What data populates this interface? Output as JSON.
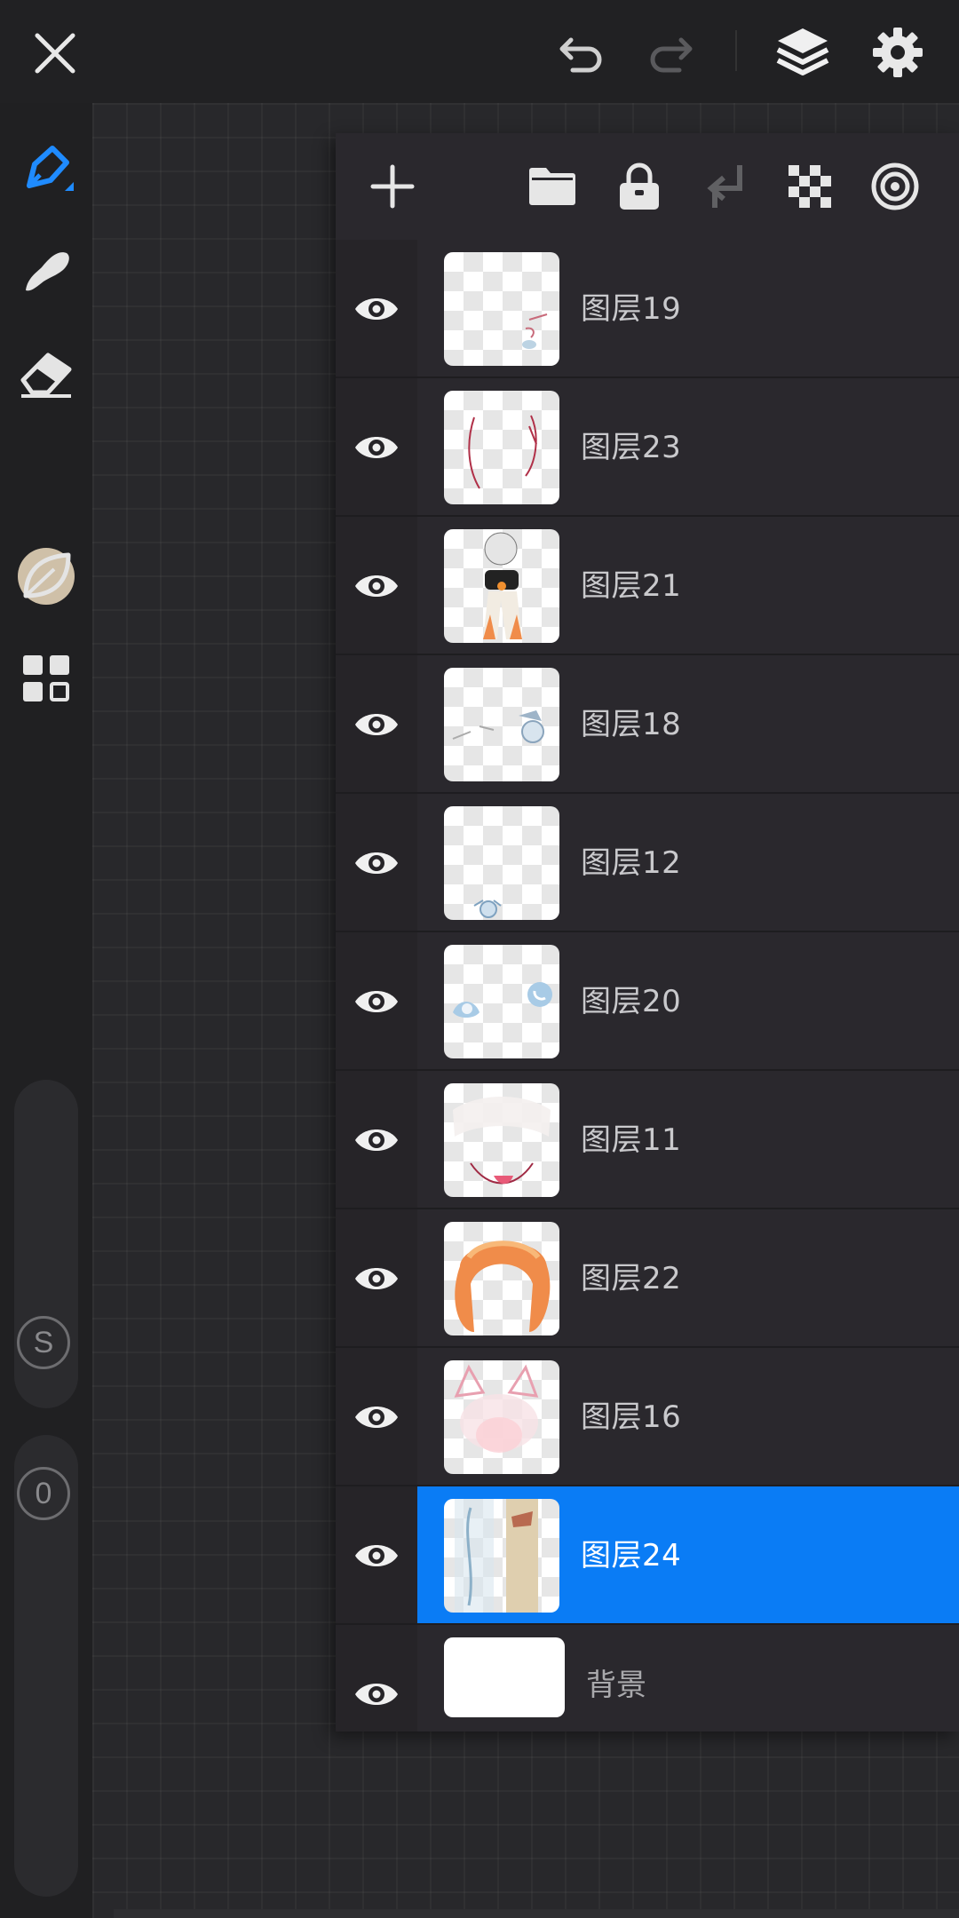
{
  "topbar": {
    "close_icon": "close-icon",
    "undo_icon": "undo-icon",
    "redo_icon": "redo-icon",
    "layers_icon": "layers-icon",
    "settings_icon": "gear-icon"
  },
  "toolbar": {
    "tools": [
      "pen-tool-icon",
      "smudge-tool-icon",
      "eraser-tool-icon",
      "color-swatch",
      "leaf-icon",
      "grid-icon"
    ],
    "current_color": "#cfc0a8",
    "size_slider_label": "S",
    "opacity_slider_label": "0"
  },
  "layers_panel": {
    "toolbar_icons": [
      "add-layer-icon",
      "folder-icon",
      "lock-icon",
      "merge-down-icon",
      "transparency-icon",
      "target-icon"
    ],
    "layers": [
      {
        "name": "图层19",
        "visible": true,
        "active": false
      },
      {
        "name": "图层23",
        "visible": true,
        "active": false
      },
      {
        "name": "图层21",
        "visible": true,
        "active": false
      },
      {
        "name": "图层18",
        "visible": true,
        "active": false
      },
      {
        "name": "图层12",
        "visible": true,
        "active": false
      },
      {
        "name": "图层20",
        "visible": true,
        "active": false
      },
      {
        "name": "图层11",
        "visible": true,
        "active": false
      },
      {
        "name": "图层22",
        "visible": true,
        "active": false
      },
      {
        "name": "图层16",
        "visible": true,
        "active": false
      },
      {
        "name": "图层24",
        "visible": true,
        "active": true
      }
    ],
    "background_layer": {
      "name": "背景",
      "visible": true
    }
  },
  "colors": {
    "accent": "#0a7cf5",
    "panel_bg": "#2a282d",
    "toolbar_bg": "#202022"
  }
}
